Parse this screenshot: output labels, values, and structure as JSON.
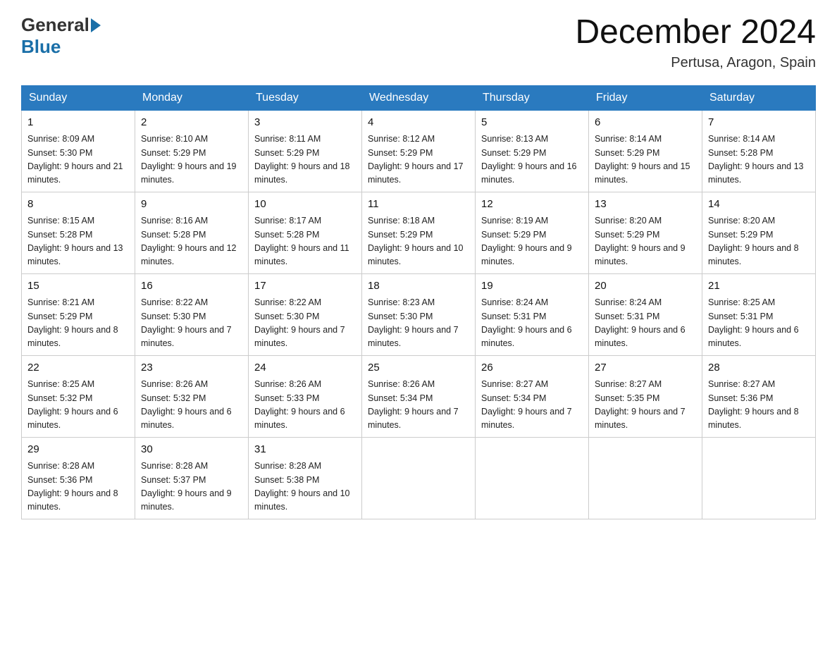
{
  "header": {
    "logo_general": "General",
    "logo_blue": "Blue",
    "month_title": "December 2024",
    "location": "Pertusa, Aragon, Spain"
  },
  "days_of_week": [
    "Sunday",
    "Monday",
    "Tuesday",
    "Wednesday",
    "Thursday",
    "Friday",
    "Saturday"
  ],
  "weeks": [
    [
      {
        "day": "1",
        "sunrise": "8:09 AM",
        "sunset": "5:30 PM",
        "daylight": "9 hours and 21 minutes."
      },
      {
        "day": "2",
        "sunrise": "8:10 AM",
        "sunset": "5:29 PM",
        "daylight": "9 hours and 19 minutes."
      },
      {
        "day": "3",
        "sunrise": "8:11 AM",
        "sunset": "5:29 PM",
        "daylight": "9 hours and 18 minutes."
      },
      {
        "day": "4",
        "sunrise": "8:12 AM",
        "sunset": "5:29 PM",
        "daylight": "9 hours and 17 minutes."
      },
      {
        "day": "5",
        "sunrise": "8:13 AM",
        "sunset": "5:29 PM",
        "daylight": "9 hours and 16 minutes."
      },
      {
        "day": "6",
        "sunrise": "8:14 AM",
        "sunset": "5:29 PM",
        "daylight": "9 hours and 15 minutes."
      },
      {
        "day": "7",
        "sunrise": "8:14 AM",
        "sunset": "5:28 PM",
        "daylight": "9 hours and 13 minutes."
      }
    ],
    [
      {
        "day": "8",
        "sunrise": "8:15 AM",
        "sunset": "5:28 PM",
        "daylight": "9 hours and 13 minutes."
      },
      {
        "day": "9",
        "sunrise": "8:16 AM",
        "sunset": "5:28 PM",
        "daylight": "9 hours and 12 minutes."
      },
      {
        "day": "10",
        "sunrise": "8:17 AM",
        "sunset": "5:28 PM",
        "daylight": "9 hours and 11 minutes."
      },
      {
        "day": "11",
        "sunrise": "8:18 AM",
        "sunset": "5:29 PM",
        "daylight": "9 hours and 10 minutes."
      },
      {
        "day": "12",
        "sunrise": "8:19 AM",
        "sunset": "5:29 PM",
        "daylight": "9 hours and 9 minutes."
      },
      {
        "day": "13",
        "sunrise": "8:20 AM",
        "sunset": "5:29 PM",
        "daylight": "9 hours and 9 minutes."
      },
      {
        "day": "14",
        "sunrise": "8:20 AM",
        "sunset": "5:29 PM",
        "daylight": "9 hours and 8 minutes."
      }
    ],
    [
      {
        "day": "15",
        "sunrise": "8:21 AM",
        "sunset": "5:29 PM",
        "daylight": "9 hours and 8 minutes."
      },
      {
        "day": "16",
        "sunrise": "8:22 AM",
        "sunset": "5:30 PM",
        "daylight": "9 hours and 7 minutes."
      },
      {
        "day": "17",
        "sunrise": "8:22 AM",
        "sunset": "5:30 PM",
        "daylight": "9 hours and 7 minutes."
      },
      {
        "day": "18",
        "sunrise": "8:23 AM",
        "sunset": "5:30 PM",
        "daylight": "9 hours and 7 minutes."
      },
      {
        "day": "19",
        "sunrise": "8:24 AM",
        "sunset": "5:31 PM",
        "daylight": "9 hours and 6 minutes."
      },
      {
        "day": "20",
        "sunrise": "8:24 AM",
        "sunset": "5:31 PM",
        "daylight": "9 hours and 6 minutes."
      },
      {
        "day": "21",
        "sunrise": "8:25 AM",
        "sunset": "5:31 PM",
        "daylight": "9 hours and 6 minutes."
      }
    ],
    [
      {
        "day": "22",
        "sunrise": "8:25 AM",
        "sunset": "5:32 PM",
        "daylight": "9 hours and 6 minutes."
      },
      {
        "day": "23",
        "sunrise": "8:26 AM",
        "sunset": "5:32 PM",
        "daylight": "9 hours and 6 minutes."
      },
      {
        "day": "24",
        "sunrise": "8:26 AM",
        "sunset": "5:33 PM",
        "daylight": "9 hours and 6 minutes."
      },
      {
        "day": "25",
        "sunrise": "8:26 AM",
        "sunset": "5:34 PM",
        "daylight": "9 hours and 7 minutes."
      },
      {
        "day": "26",
        "sunrise": "8:27 AM",
        "sunset": "5:34 PM",
        "daylight": "9 hours and 7 minutes."
      },
      {
        "day": "27",
        "sunrise": "8:27 AM",
        "sunset": "5:35 PM",
        "daylight": "9 hours and 7 minutes."
      },
      {
        "day": "28",
        "sunrise": "8:27 AM",
        "sunset": "5:36 PM",
        "daylight": "9 hours and 8 minutes."
      }
    ],
    [
      {
        "day": "29",
        "sunrise": "8:28 AM",
        "sunset": "5:36 PM",
        "daylight": "9 hours and 8 minutes."
      },
      {
        "day": "30",
        "sunrise": "8:28 AM",
        "sunset": "5:37 PM",
        "daylight": "9 hours and 9 minutes."
      },
      {
        "day": "31",
        "sunrise": "8:28 AM",
        "sunset": "5:38 PM",
        "daylight": "9 hours and 10 minutes."
      },
      null,
      null,
      null,
      null
    ]
  ]
}
